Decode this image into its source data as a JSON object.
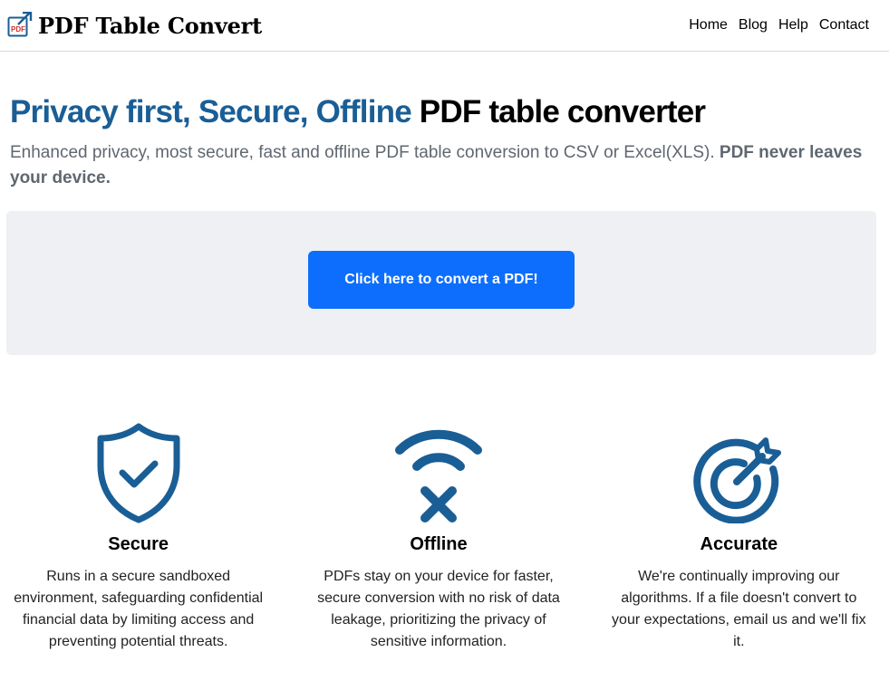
{
  "header": {
    "brand_name": "PDF Table Convert",
    "logo_text": "PDF",
    "nav": [
      {
        "label": "Home"
      },
      {
        "label": "Blog"
      },
      {
        "label": "Help"
      },
      {
        "label": "Contact"
      }
    ]
  },
  "hero": {
    "title_accent": "Privacy first, Secure, Offline",
    "title_rest": " PDF table converter",
    "lead_text": "Enhanced privacy, most secure, fast and offline PDF table conversion to CSV or Excel(XLS). ",
    "lead_bold": "PDF never leaves your device."
  },
  "convert": {
    "button_label": "Click here to convert a PDF!"
  },
  "features": [
    {
      "icon": "shield-check-icon",
      "title": "Secure",
      "text": "Runs in a secure sandboxed environment, safeguarding confidential financial data by limiting access and preventing potential threats."
    },
    {
      "icon": "wifi-off-icon",
      "title": "Offline",
      "text": "PDFs stay on your device for faster, secure conversion with no risk of data leakage, prioritizing the privacy of sensitive information."
    },
    {
      "icon": "target-icon",
      "title": "Accurate",
      "text": "We're continually improving our algorithms. If a file doesn't convert to your expectations, email us and we'll fix it."
    }
  ],
  "colors": {
    "accent": "#1a5e96",
    "button": "#0d6efd",
    "panel": "#eff0f3",
    "logo_red": "#d0312d"
  }
}
